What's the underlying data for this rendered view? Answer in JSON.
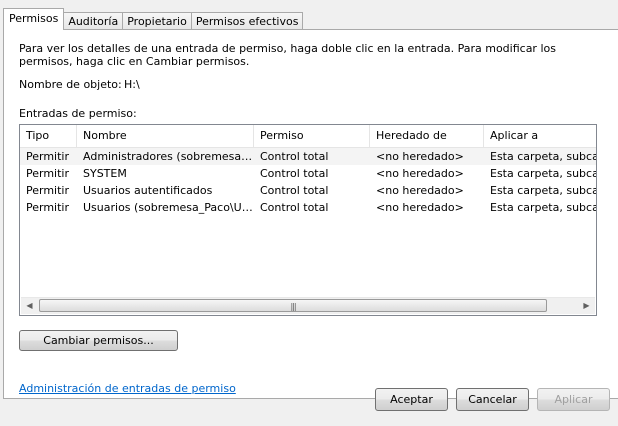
{
  "tabs": [
    {
      "label": "Permisos",
      "active": true
    },
    {
      "label": "Auditoría",
      "active": false
    },
    {
      "label": "Propietario",
      "active": false
    },
    {
      "label": "Permisos efectivos",
      "active": false
    }
  ],
  "intro_text": "Para ver los detalles de una entrada de permiso, haga doble clic en la entrada. Para modificar los permisos, haga clic en Cambiar permisos.",
  "object_label": "Nombre de objeto:",
  "object_value": "H:\\",
  "entries_label": "Entradas de permiso:",
  "columns": [
    "Tipo",
    "Nombre",
    "Permiso",
    "Heredado de",
    "Aplicar a"
  ],
  "rows": [
    [
      "Permitir",
      "Administradores (sobremesa_Pac...",
      "Control total",
      "<no heredado>",
      "Esta carpeta, subcarp"
    ],
    [
      "Permitir",
      "SYSTEM",
      "Control total",
      "<no heredado>",
      "Esta carpeta, subcarp"
    ],
    [
      "Permitir",
      "Usuarios autentificados",
      "Control total",
      "<no heredado>",
      "Esta carpeta, subcarp"
    ],
    [
      "Permitir",
      "Usuarios (sobremesa_Paco\\Usu...",
      "Control total",
      "<no heredado>",
      "Esta carpeta, subcarp"
    ]
  ],
  "change_button": "Cambiar permisos...",
  "link_text": "Administración de entradas de permiso",
  "bottom_buttons": [
    "Aceptar",
    "Cancelar",
    "Aplicar"
  ],
  "colors": {
    "link": "#0066cc",
    "panel_border": "#a9a9a9"
  }
}
